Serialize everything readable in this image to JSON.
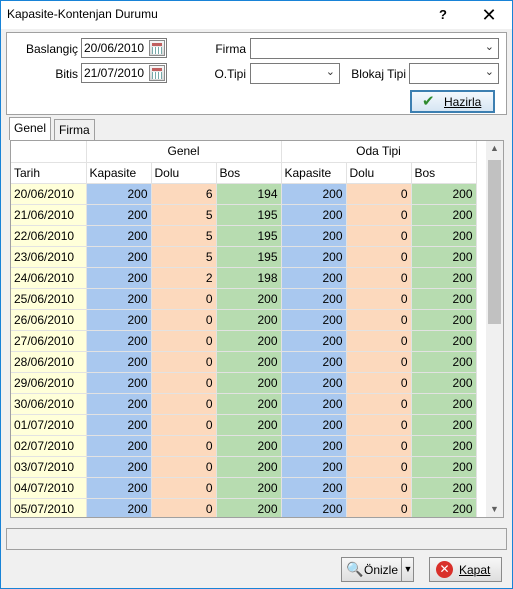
{
  "window": {
    "title": "Kapasite-Kontenjan Durumu",
    "help": "?",
    "close": "✕"
  },
  "filters": {
    "baslangic_label": "Baslangiç",
    "baslangic_value": "20/06/2010",
    "bitis_label": "Bitis",
    "bitis_value": "21/07/2010",
    "firma_label": "Firma",
    "firma_value": "",
    "otipi_label": "O.Tipi",
    "otipi_value": "",
    "blokaj_label": "Blokaj Tipi",
    "blokaj_value": "",
    "hazirla_label": "Hazirla"
  },
  "tabs": [
    {
      "label": "Genel"
    },
    {
      "label": "Firma"
    }
  ],
  "grid": {
    "groups": {
      "genel": "Genel",
      "oda_tipi": "Oda Tipi"
    },
    "columns": [
      "Tarih",
      "Kapasite",
      "Dolu",
      "Bos",
      "Kapasite",
      "Dolu",
      "Bos"
    ],
    "rows": [
      [
        "20/06/2010",
        "200",
        "6",
        "194",
        "200",
        "0",
        "200"
      ],
      [
        "21/06/2010",
        "200",
        "5",
        "195",
        "200",
        "0",
        "200"
      ],
      [
        "22/06/2010",
        "200",
        "5",
        "195",
        "200",
        "0",
        "200"
      ],
      [
        "23/06/2010",
        "200",
        "5",
        "195",
        "200",
        "0",
        "200"
      ],
      [
        "24/06/2010",
        "200",
        "2",
        "198",
        "200",
        "0",
        "200"
      ],
      [
        "25/06/2010",
        "200",
        "0",
        "200",
        "200",
        "0",
        "200"
      ],
      [
        "26/06/2010",
        "200",
        "0",
        "200",
        "200",
        "0",
        "200"
      ],
      [
        "27/06/2010",
        "200",
        "0",
        "200",
        "200",
        "0",
        "200"
      ],
      [
        "28/06/2010",
        "200",
        "0",
        "200",
        "200",
        "0",
        "200"
      ],
      [
        "29/06/2010",
        "200",
        "0",
        "200",
        "200",
        "0",
        "200"
      ],
      [
        "30/06/2010",
        "200",
        "0",
        "200",
        "200",
        "0",
        "200"
      ],
      [
        "01/07/2010",
        "200",
        "0",
        "200",
        "200",
        "0",
        "200"
      ],
      [
        "02/07/2010",
        "200",
        "0",
        "200",
        "200",
        "0",
        "200"
      ],
      [
        "03/07/2010",
        "200",
        "0",
        "200",
        "200",
        "0",
        "200"
      ],
      [
        "04/07/2010",
        "200",
        "0",
        "200",
        "200",
        "0",
        "200"
      ],
      [
        "05/07/2010",
        "200",
        "0",
        "200",
        "200",
        "0",
        "200"
      ]
    ]
  },
  "footer": {
    "onizle_label": "Önizle",
    "kapat_label": "Kapat"
  },
  "icons": {
    "calendar": "calendar-icon",
    "check": "check-icon",
    "preview": "magnifier-icon",
    "close": "close-circle-icon"
  },
  "colors": {
    "date_bg": "#ffffd9",
    "kapasite_bg": "#a9c8ef",
    "dolu_bg": "#fcd9bd",
    "bos_bg": "#b7dcb0",
    "window_border": "#1883d7"
  }
}
